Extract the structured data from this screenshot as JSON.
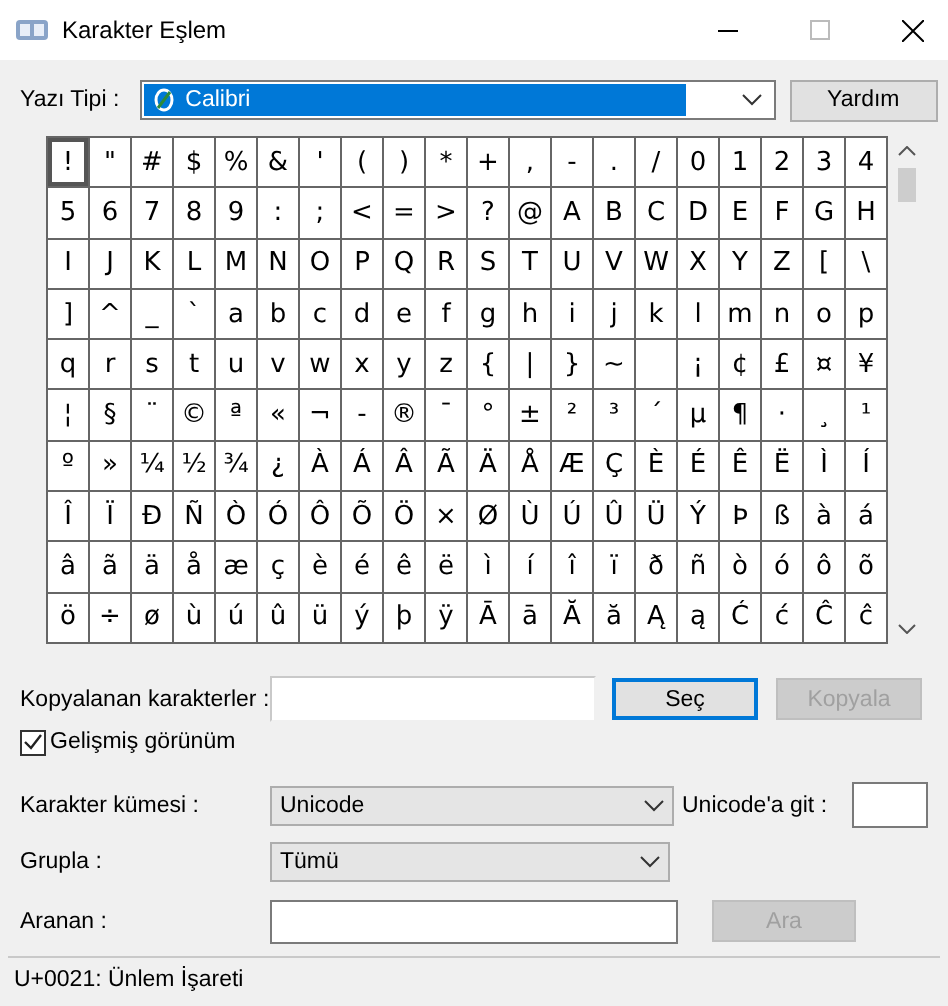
{
  "window": {
    "title": "Karakter Eşlem"
  },
  "font_row": {
    "label": "Yazı Tipi :",
    "value": "Calibri",
    "help_button": "Yardım"
  },
  "grid": [
    [
      {
        "c": "!",
        "selected": true
      },
      {
        "c": "\"",
        "selected": false
      },
      {
        "c": "#",
        "selected": false
      },
      {
        "c": "$",
        "selected": false
      },
      {
        "c": "%",
        "selected": false
      },
      {
        "c": "&",
        "selected": false
      },
      {
        "c": "'",
        "selected": false
      },
      {
        "c": "(",
        "selected": false
      },
      {
        "c": ")",
        "selected": false
      },
      {
        "c": "*",
        "selected": false
      },
      {
        "c": "+",
        "selected": false
      },
      {
        "c": ",",
        "selected": false
      },
      {
        "c": "-",
        "selected": false
      },
      {
        "c": ".",
        "selected": false
      },
      {
        "c": "/",
        "selected": false
      },
      {
        "c": "0",
        "selected": false
      },
      {
        "c": "1",
        "selected": false
      },
      {
        "c": "2",
        "selected": false
      },
      {
        "c": "3",
        "selected": false
      },
      {
        "c": "4",
        "selected": false
      }
    ],
    [
      {
        "c": "5",
        "selected": false
      },
      {
        "c": "6",
        "selected": false
      },
      {
        "c": "7",
        "selected": false
      },
      {
        "c": "8",
        "selected": false
      },
      {
        "c": "9",
        "selected": false
      },
      {
        "c": ":",
        "selected": false
      },
      {
        "c": ";",
        "selected": false
      },
      {
        "c": "<",
        "selected": false
      },
      {
        "c": "=",
        "selected": false
      },
      {
        "c": ">",
        "selected": false
      },
      {
        "c": "?",
        "selected": false
      },
      {
        "c": "@",
        "selected": false
      },
      {
        "c": "A",
        "selected": false
      },
      {
        "c": "B",
        "selected": false
      },
      {
        "c": "C",
        "selected": false
      },
      {
        "c": "D",
        "selected": false
      },
      {
        "c": "E",
        "selected": false
      },
      {
        "c": "F",
        "selected": false
      },
      {
        "c": "G",
        "selected": false
      },
      {
        "c": "H",
        "selected": false
      }
    ],
    [
      {
        "c": "I",
        "selected": false
      },
      {
        "c": "J",
        "selected": false
      },
      {
        "c": "K",
        "selected": false
      },
      {
        "c": "L",
        "selected": false
      },
      {
        "c": "M",
        "selected": false
      },
      {
        "c": "N",
        "selected": false
      },
      {
        "c": "O",
        "selected": false
      },
      {
        "c": "P",
        "selected": false
      },
      {
        "c": "Q",
        "selected": false
      },
      {
        "c": "R",
        "selected": false
      },
      {
        "c": "S",
        "selected": false
      },
      {
        "c": "T",
        "selected": false
      },
      {
        "c": "U",
        "selected": false
      },
      {
        "c": "V",
        "selected": false
      },
      {
        "c": "W",
        "selected": false
      },
      {
        "c": "X",
        "selected": false
      },
      {
        "c": "Y",
        "selected": false
      },
      {
        "c": "Z",
        "selected": false
      },
      {
        "c": "[",
        "selected": false
      },
      {
        "c": "\\",
        "selected": false
      }
    ],
    [
      {
        "c": "]",
        "selected": false
      },
      {
        "c": "^",
        "selected": false
      },
      {
        "c": "_",
        "selected": false
      },
      {
        "c": "`",
        "selected": false
      },
      {
        "c": "a",
        "selected": false
      },
      {
        "c": "b",
        "selected": false
      },
      {
        "c": "c",
        "selected": false
      },
      {
        "c": "d",
        "selected": false
      },
      {
        "c": "e",
        "selected": false
      },
      {
        "c": "f",
        "selected": false
      },
      {
        "c": "g",
        "selected": false
      },
      {
        "c": "h",
        "selected": false
      },
      {
        "c": "i",
        "selected": false
      },
      {
        "c": "j",
        "selected": false
      },
      {
        "c": "k",
        "selected": false
      },
      {
        "c": "l",
        "selected": false
      },
      {
        "c": "m",
        "selected": false
      },
      {
        "c": "n",
        "selected": false
      },
      {
        "c": "o",
        "selected": false
      },
      {
        "c": "p",
        "selected": false
      }
    ],
    [
      {
        "c": "q",
        "selected": false
      },
      {
        "c": "r",
        "selected": false
      },
      {
        "c": "s",
        "selected": false
      },
      {
        "c": "t",
        "selected": false
      },
      {
        "c": "u",
        "selected": false
      },
      {
        "c": "v",
        "selected": false
      },
      {
        "c": "w",
        "selected": false
      },
      {
        "c": "x",
        "selected": false
      },
      {
        "c": "y",
        "selected": false
      },
      {
        "c": "z",
        "selected": false
      },
      {
        "c": "{",
        "selected": false
      },
      {
        "c": "|",
        "selected": false
      },
      {
        "c": "}",
        "selected": false
      },
      {
        "c": "~",
        "selected": false
      },
      {
        "selected": false
      },
      {
        "c": "¡",
        "selected": false
      },
      {
        "c": "¢",
        "selected": false
      },
      {
        "c": "£",
        "selected": false
      },
      {
        "c": "¤",
        "selected": false
      },
      {
        "c": "¥",
        "selected": false
      }
    ],
    [
      {
        "c": "¦",
        "selected": false
      },
      {
        "c": "§",
        "selected": false
      },
      {
        "c": "¨",
        "selected": false
      },
      {
        "c": "©",
        "selected": false
      },
      {
        "c": "ª",
        "selected": false
      },
      {
        "c": "«",
        "selected": false
      },
      {
        "c": "¬",
        "selected": false
      },
      {
        "c": "-",
        "selected": false
      },
      {
        "c": "®",
        "selected": false
      },
      {
        "c": "¯",
        "selected": false
      },
      {
        "c": "°",
        "selected": false
      },
      {
        "c": "±",
        "selected": false
      },
      {
        "c": "²",
        "selected": false
      },
      {
        "c": "³",
        "selected": false
      },
      {
        "c": "´",
        "selected": false
      },
      {
        "c": "µ",
        "selected": false
      },
      {
        "c": "¶",
        "selected": false
      },
      {
        "c": "·",
        "selected": false
      },
      {
        "c": "¸",
        "selected": false
      },
      {
        "c": "¹",
        "selected": false
      }
    ],
    [
      {
        "c": "º",
        "selected": false
      },
      {
        "c": "»",
        "selected": false
      },
      {
        "c": "¼",
        "selected": false
      },
      {
        "c": "½",
        "selected": false
      },
      {
        "c": "¾",
        "selected": false
      },
      {
        "c": "¿",
        "selected": false
      },
      {
        "c": "À",
        "selected": false
      },
      {
        "c": "Á",
        "selected": false
      },
      {
        "c": "Â",
        "selected": false
      },
      {
        "c": "Ã",
        "selected": false
      },
      {
        "c": "Ä",
        "selected": false
      },
      {
        "c": "Å",
        "selected": false
      },
      {
        "c": "Æ",
        "selected": false
      },
      {
        "c": "Ç",
        "selected": false
      },
      {
        "c": "È",
        "selected": false
      },
      {
        "c": "É",
        "selected": false
      },
      {
        "c": "Ê",
        "selected": false
      },
      {
        "c": "Ë",
        "selected": false
      },
      {
        "c": "Ì",
        "selected": false
      },
      {
        "c": "Í",
        "selected": false
      }
    ],
    [
      {
        "c": "Î",
        "selected": false
      },
      {
        "c": "Ï",
        "selected": false
      },
      {
        "c": "Ð",
        "selected": false
      },
      {
        "c": "Ñ",
        "selected": false
      },
      {
        "c": "Ò",
        "selected": false
      },
      {
        "c": "Ó",
        "selected": false
      },
      {
        "c": "Ô",
        "selected": false
      },
      {
        "c": "Õ",
        "selected": false
      },
      {
        "c": "Ö",
        "selected": false
      },
      {
        "c": "×",
        "selected": false
      },
      {
        "c": "Ø",
        "selected": false
      },
      {
        "c": "Ù",
        "selected": false
      },
      {
        "c": "Ú",
        "selected": false
      },
      {
        "c": "Û",
        "selected": false
      },
      {
        "c": "Ü",
        "selected": false
      },
      {
        "c": "Ý",
        "selected": false
      },
      {
        "c": "Þ",
        "selected": false
      },
      {
        "c": "ß",
        "selected": false
      },
      {
        "c": "à",
        "selected": false
      },
      {
        "c": "á",
        "selected": false
      }
    ],
    [
      {
        "c": "â",
        "selected": false
      },
      {
        "c": "ã",
        "selected": false
      },
      {
        "c": "ä",
        "selected": false
      },
      {
        "c": "å",
        "selected": false
      },
      {
        "c": "æ",
        "selected": false
      },
      {
        "c": "ç",
        "selected": false
      },
      {
        "c": "è",
        "selected": false
      },
      {
        "c": "é",
        "selected": false
      },
      {
        "c": "ê",
        "selected": false
      },
      {
        "c": "ë",
        "selected": false
      },
      {
        "c": "ì",
        "selected": false
      },
      {
        "c": "í",
        "selected": false
      },
      {
        "c": "î",
        "selected": false
      },
      {
        "c": "ï",
        "selected": false
      },
      {
        "c": "ð",
        "selected": false
      },
      {
        "c": "ñ",
        "selected": false
      },
      {
        "c": "ò",
        "selected": false
      },
      {
        "c": "ó",
        "selected": false
      },
      {
        "c": "ô",
        "selected": false
      },
      {
        "c": "õ",
        "selected": false
      }
    ],
    [
      {
        "c": "ö",
        "selected": false
      },
      {
        "c": "÷",
        "selected": false
      },
      {
        "c": "ø",
        "selected": false
      },
      {
        "c": "ù",
        "selected": false
      },
      {
        "c": "ú",
        "selected": false
      },
      {
        "c": "û",
        "selected": false
      },
      {
        "c": "ü",
        "selected": false
      },
      {
        "c": "ý",
        "selected": false
      },
      {
        "c": "þ",
        "selected": false
      },
      {
        "c": "ÿ",
        "selected": false
      },
      {
        "c": "Ā",
        "selected": false
      },
      {
        "c": "ā",
        "selected": false
      },
      {
        "c": "Ă",
        "selected": false
      },
      {
        "c": "ă",
        "selected": false
      },
      {
        "c": "Ą",
        "selected": false
      },
      {
        "c": "ą",
        "selected": false
      },
      {
        "c": "Ć",
        "selected": false
      },
      {
        "c": "ć",
        "selected": false
      },
      {
        "c": "Ĉ",
        "selected": false
      },
      {
        "c": "ĉ",
        "selected": false
      }
    ]
  ],
  "copy_row": {
    "label": "Kopyalanan karakterler :",
    "select_button": "Seç",
    "copy_button": {
      "label": "Kopyala",
      "disabled": true
    }
  },
  "advanced_view": {
    "label": "Gelişmiş görünüm",
    "checked": true
  },
  "charset": {
    "label": "Karakter kümesi :",
    "value": "Unicode"
  },
  "goto_unicode": {
    "label": "Unicode'a git :"
  },
  "group_by": {
    "label": "Grupla :",
    "value": "Tümü"
  },
  "search": {
    "label": "Aranan :",
    "button": {
      "label": "Ara",
      "disabled": true
    }
  },
  "status_bar": "U+0021: Ünlem İşareti"
}
